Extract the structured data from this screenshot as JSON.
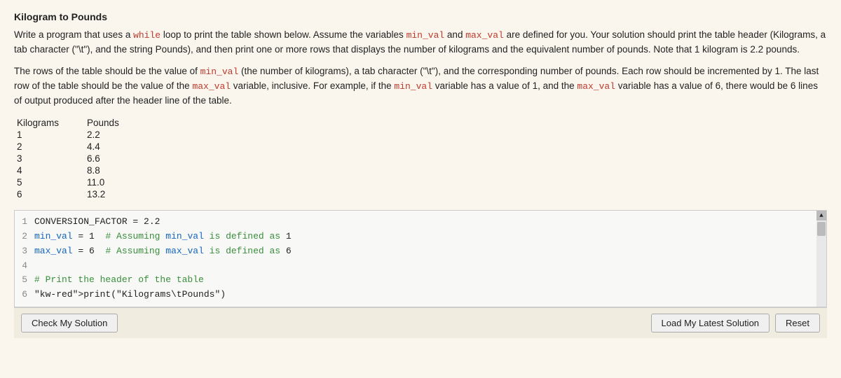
{
  "page": {
    "title": "Kilogram to Pounds",
    "problem_paragraphs": [
      "Write a program that uses a while loop to print the table shown below. Assume the variables min_val and max_val are defined for you. Your solution should print the table header (Kilograms, a tab character (\"\\t\"), and the string Pounds), and then print one or more rows that displays the number of kilograms and the equivalent number of pounds. Note that 1 kilogram is 2.2 pounds.",
      "The rows of the table should be the value of min_val (the number of kilograms), a tab character (\"\\t\"), and the corresponding number of pounds. Each row should be incremented by 1. The last row of the table should be the value of the max_val variable, inclusive. For example, if the min_val variable has a value of 1, and the max_val variable has a value of 6, there would be 6 lines of output produced after the header line of the table."
    ],
    "table": {
      "header": [
        "Kilograms",
        "Pounds"
      ],
      "rows": [
        [
          "1",
          "2.2"
        ],
        [
          "2",
          "4.4"
        ],
        [
          "3",
          "6.6"
        ],
        [
          "4",
          "8.8"
        ],
        [
          "5",
          "11.0"
        ],
        [
          "6",
          "13.2"
        ]
      ]
    },
    "code_lines": [
      {
        "num": 1,
        "text": "CONVERSION_FACTOR = 2.2"
      },
      {
        "num": 2,
        "text": "min_val = 1  # Assuming min_val is defined as 1"
      },
      {
        "num": 3,
        "text": "max_val = 6  # Assuming max_val is defined as 6"
      },
      {
        "num": 4,
        "text": ""
      },
      {
        "num": 5,
        "text": "# Print the header of the table"
      },
      {
        "num": 6,
        "text": "print(\"Kilograms\\tPounds\")"
      }
    ],
    "buttons": {
      "check": "Check My Solution",
      "load": "Load My Latest Solution",
      "reset": "Reset"
    }
  }
}
